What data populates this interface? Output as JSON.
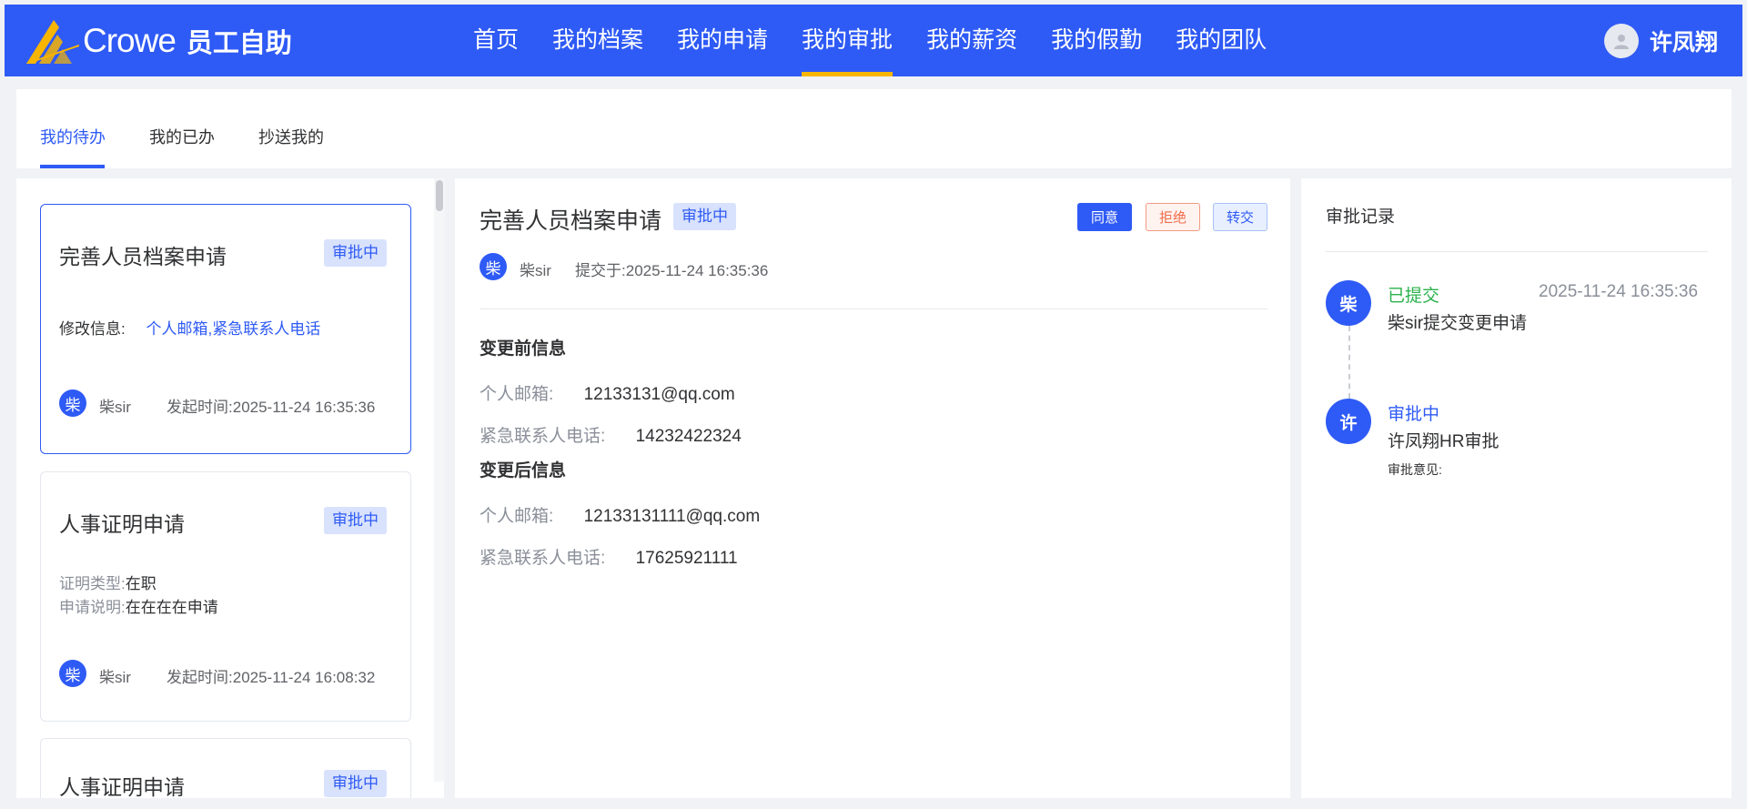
{
  "app": {
    "logo_text": "Crowe",
    "subtitle": "员工自助"
  },
  "nav": {
    "items": [
      "首页",
      "我的档案",
      "我的申请",
      "我的审批",
      "我的薪资",
      "我的假勤",
      "我的团队"
    ],
    "active": "我的审批"
  },
  "user": {
    "name": "许凤翔"
  },
  "tabs": [
    "我的待办",
    "我的已办",
    "抄送我的"
  ],
  "list": {
    "cards": [
      {
        "title": "完善人员档案申请",
        "status": "审批中",
        "field1_label": "修改信息:",
        "field1_value": "个人邮箱,紧急联系人电话",
        "avatar": "柴",
        "user": "柴sir",
        "time_label": "发起时间:",
        "time": "2025-11-24 16:35:36"
      },
      {
        "title": "人事证明申请",
        "status": "审批中",
        "field1_label": "证明类型:",
        "field1_value": "在职",
        "field2_label": "申请说明:",
        "field2_value": "在在在在申请",
        "avatar": "柴",
        "user": "柴sir",
        "time_label": "发起时间:",
        "time": "2025-11-24 16:08:32"
      },
      {
        "title": "人事证明申请",
        "status": "审批中"
      }
    ]
  },
  "detail": {
    "title": "完善人员档案申请",
    "status": "审批中",
    "buttons": {
      "agree": "同意",
      "reject": "拒绝",
      "transfer": "转交"
    },
    "avatar": "柴",
    "user": "柴sir",
    "submit_label": "提交于:",
    "submit_time": "2025-11-24 16:35:36",
    "before_header": "变更前信息",
    "before": [
      {
        "label": "个人邮箱:",
        "value": "12133131@qq.com"
      },
      {
        "label": "紧急联系人电话:",
        "value": "14232422324"
      }
    ],
    "after_header": "变更后信息",
    "after": [
      {
        "label": "个人邮箱:",
        "value": "12133131111@qq.com"
      },
      {
        "label": "紧急联系人电话:",
        "value": "17625921111"
      }
    ]
  },
  "history": {
    "title": "审批记录",
    "records": [
      {
        "avatar": "柴",
        "status": "已提交",
        "status_color": "#2bb24c",
        "time": "2025-11-24 16:35:36",
        "desc": "柴sir提交变更申请"
      },
      {
        "avatar": "许",
        "status": "审批中",
        "status_color": "#2e5af5",
        "desc": "许凤翔HR审批",
        "comment_label": "审批意见:"
      }
    ]
  },
  "colors": {
    "primary": "#2e5af5",
    "nav_indicator": "#f7b500",
    "success": "#2bb24c",
    "danger": "#f06b48"
  }
}
